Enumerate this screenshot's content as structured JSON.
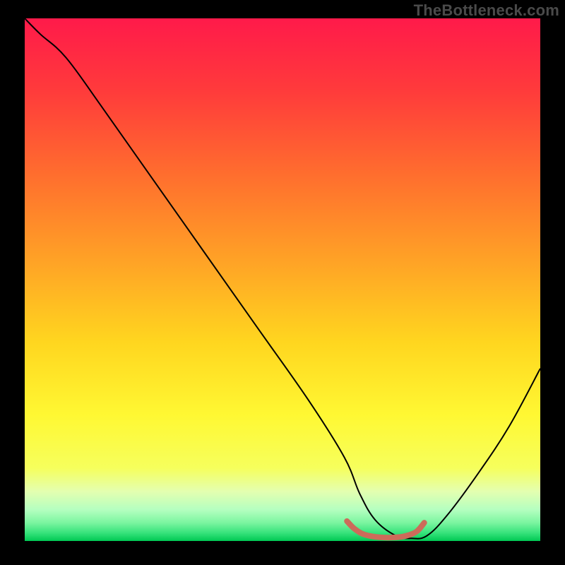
{
  "watermark": "TheBottleneck.com",
  "chart_data": {
    "type": "line",
    "title": "",
    "xlabel": "",
    "ylabel": "",
    "xlim": [
      0,
      100
    ],
    "ylim": [
      0,
      100
    ],
    "grid": false,
    "legend": false,
    "gradient_stops": [
      {
        "pos": 0.0,
        "color": "#ff1a4a"
      },
      {
        "pos": 0.14,
        "color": "#ff3b3b"
      },
      {
        "pos": 0.3,
        "color": "#ff6e2e"
      },
      {
        "pos": 0.46,
        "color": "#ffa126"
      },
      {
        "pos": 0.62,
        "color": "#ffd61f"
      },
      {
        "pos": 0.76,
        "color": "#fff833"
      },
      {
        "pos": 0.86,
        "color": "#f6ff5c"
      },
      {
        "pos": 0.905,
        "color": "#e4ffb0"
      },
      {
        "pos": 0.94,
        "color": "#b5ffc0"
      },
      {
        "pos": 0.965,
        "color": "#7bf5a0"
      },
      {
        "pos": 0.985,
        "color": "#35e27a"
      },
      {
        "pos": 1.0,
        "color": "#00c853"
      }
    ],
    "series": [
      {
        "name": "bottleneck-curve",
        "color": "#000000",
        "width": 2,
        "x": [
          0,
          3,
          8,
          15,
          25,
          35,
          45,
          55,
          62,
          65,
          68,
          72,
          75,
          78,
          82,
          88,
          94,
          100
        ],
        "y": [
          100,
          97,
          92.5,
          83,
          69,
          55,
          41,
          27,
          16,
          9,
          4,
          1,
          0.5,
          1,
          5,
          13,
          22,
          33
        ]
      },
      {
        "name": "optimal-band",
        "color": "#cc6b5a",
        "width": 8,
        "cap": "round",
        "x": [
          62.5,
          64,
          66,
          69,
          72,
          74,
          76,
          77.5
        ],
        "y": [
          3.8,
          2.3,
          1.2,
          0.7,
          0.7,
          1.0,
          1.8,
          3.5
        ]
      }
    ]
  }
}
